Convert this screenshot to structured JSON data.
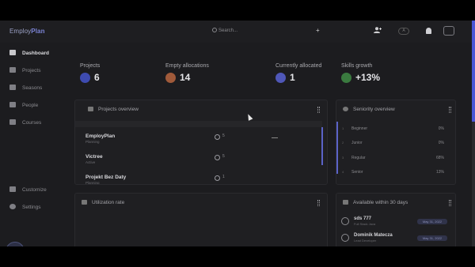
{
  "topbar": {
    "logo_prefix": "Employ",
    "logo_suffix": "Plan",
    "search_placeholder": "Search...",
    "add_icon": "+",
    "add_user_icon": "person-add-icon",
    "language_label": "A",
    "bell_icon": "bell-icon",
    "avatar_icon": "avatar-icon"
  },
  "sidebar": {
    "items": [
      {
        "label": "Dashboard",
        "icon": "dashboard-icon",
        "active": true
      },
      {
        "label": "Projects",
        "icon": "document-icon",
        "active": false
      },
      {
        "label": "Seasons",
        "icon": "calendar-icon",
        "active": false
      },
      {
        "label": "People",
        "icon": "people-icon",
        "active": false
      },
      {
        "label": "Courses",
        "icon": "graduation-cap-icon",
        "active": false
      }
    ],
    "bottom_items": [
      {
        "label": "Customize",
        "icon": "sliders-icon"
      },
      {
        "label": "Settings",
        "icon": "gear-icon"
      }
    ]
  },
  "stats": [
    {
      "label": "Projects",
      "value": "6",
      "color": "#3e4bb0"
    },
    {
      "label": "Empty allocations",
      "value": "14",
      "color": "#a05a3a"
    },
    {
      "label": "Currently allocated",
      "value": "1",
      "color": "#4f57b8"
    },
    {
      "label": "Skills growth",
      "value": "+13%",
      "color": "#3a7a3f"
    }
  ],
  "projects_overview": {
    "title": "Projects overview",
    "projects": [
      {
        "name": "EmployPlan",
        "status": "Planning",
        "count": "5"
      },
      {
        "name": "Victree",
        "status": "Active",
        "count": "5"
      },
      {
        "name": "Projekt Bez Daty",
        "status": "Planning",
        "count": "1"
      }
    ]
  },
  "seniority_overview": {
    "title": "Seniority overview",
    "rows": [
      {
        "num": "1",
        "name": "Beginner",
        "pct": "0%"
      },
      {
        "num": "2",
        "name": "Junior",
        "pct": "0%"
      },
      {
        "num": "3",
        "name": "Regular",
        "pct": "68%"
      },
      {
        "num": "4",
        "name": "Senior",
        "pct": "13%"
      }
    ]
  },
  "utilization": {
    "title": "Utilization rate"
  },
  "available": {
    "title": "Available within 30 days",
    "people": [
      {
        "name": "sds 777",
        "role": "Full Stack Java",
        "date": "May 31, 2022"
      },
      {
        "name": "Dominik Matecza",
        "role": "Lead Developer",
        "date": "May 31, 2022"
      }
    ]
  },
  "colors": {
    "accent": "#5b63c8",
    "scrollbar": "#4a56d6"
  }
}
